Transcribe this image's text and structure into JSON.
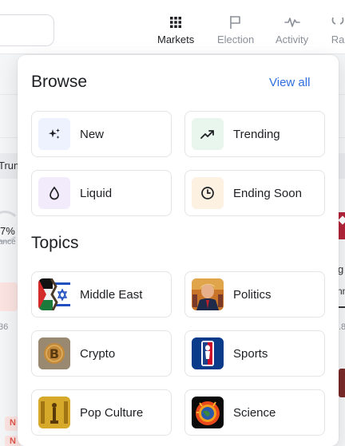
{
  "nav": {
    "items": [
      {
        "label": "Markets",
        "icon": "grid-icon",
        "active": true
      },
      {
        "label": "Election",
        "icon": "flag-icon",
        "active": false
      },
      {
        "label": "Activity",
        "icon": "activity-icon",
        "active": false
      },
      {
        "label": "Ra",
        "icon": "ranks-icon",
        "active": false
      }
    ]
  },
  "background": {
    "pill_text": "Trum",
    "gauge_percent": "7%",
    "gauge_sub": "ance",
    "left_num": "36",
    "badge": "N",
    "right_g": "g",
    "right_m": "nn",
    "right_num": ".8"
  },
  "dropdown": {
    "browse_title": "Browse",
    "view_all": "View all",
    "browse": [
      {
        "label": "New",
        "icon": "sparkle-icon",
        "icon_bg": "#eef2ff"
      },
      {
        "label": "Trending",
        "icon": "trending-up-icon",
        "icon_bg": "#e9f6ee"
      },
      {
        "label": "Liquid",
        "icon": "droplet-icon",
        "icon_bg": "#f1ebfb"
      },
      {
        "label": "Ending Soon",
        "icon": "clock-icon",
        "icon_bg": "#fdf1e1"
      }
    ],
    "topics_title": "Topics",
    "topics": [
      {
        "label": "Middle East",
        "icon": "middle-east-thumbnail"
      },
      {
        "label": "Politics",
        "icon": "politics-thumbnail"
      },
      {
        "label": "Crypto",
        "icon": "bitcoin-thumbnail"
      },
      {
        "label": "Sports",
        "icon": "nba-logo-thumbnail"
      },
      {
        "label": "Pop Culture",
        "icon": "oscar-thumbnail"
      },
      {
        "label": "Science",
        "icon": "planet-thumbnail"
      }
    ]
  },
  "colors": {
    "accent": "#2f6fde",
    "text": "#1d1f23",
    "muted": "#8a8f98"
  }
}
